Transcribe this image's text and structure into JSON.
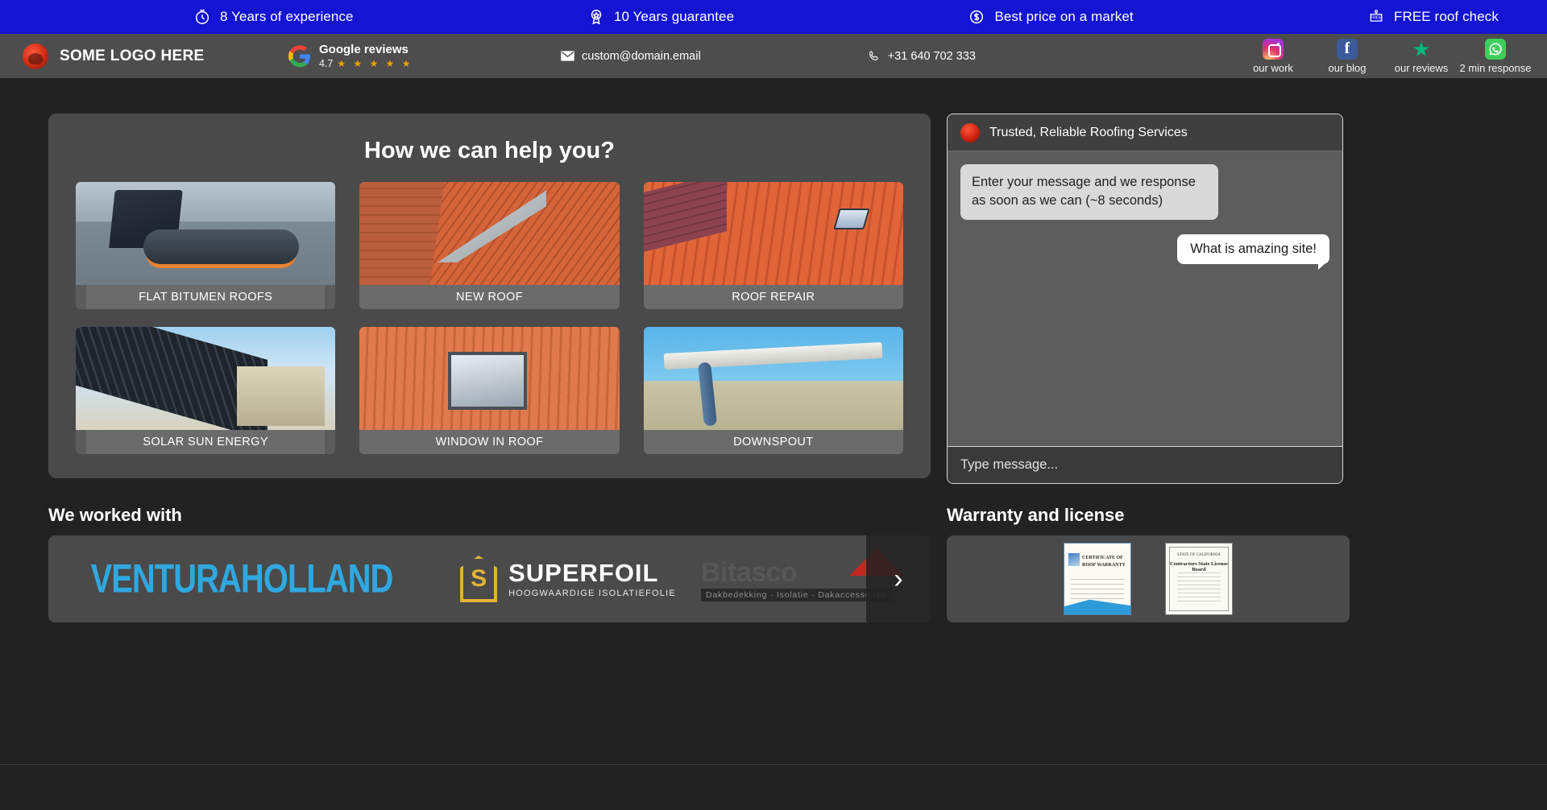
{
  "promo_bar": {
    "background": "#1414d2",
    "items": [
      {
        "icon": "clock-icon",
        "label": "8 Years of experience"
      },
      {
        "icon": "guarantee-badge-icon",
        "label": "10 Years guarantee"
      },
      {
        "icon": "dollar-coin-icon",
        "label": "Best price on a market"
      },
      {
        "icon": "free-tag-icon",
        "label": "FREE roof check"
      }
    ]
  },
  "header": {
    "brand": {
      "logo": "company-logo-icon",
      "name": "SOME LOGO HERE"
    },
    "google": {
      "icon": "google-g-icon",
      "title": "Google reviews",
      "score": "4.7",
      "stars": "★ ★ ★ ★ ★",
      "star_color": "#f0a202"
    },
    "email": {
      "icon": "mail-icon",
      "value": "custom@domain.email"
    },
    "phone": {
      "icon": "phone-icon",
      "value": "+31 640 702 333"
    },
    "socials": [
      {
        "icon": "instagram-icon",
        "label": "our work"
      },
      {
        "icon": "facebook-icon",
        "label": "our blog"
      },
      {
        "icon": "trustpilot-star-icon",
        "label": "our reviews"
      },
      {
        "icon": "whatsapp-icon",
        "label": "2 min response"
      }
    ]
  },
  "services": {
    "title": "How we can help you?",
    "tiles": [
      {
        "label": "FLAT BITUMEN ROOFS",
        "art": "bitumen"
      },
      {
        "label": "NEW ROOF",
        "art": "brickwall"
      },
      {
        "label": "ROOF REPAIR",
        "art": "tilesroof"
      },
      {
        "label": "SOLAR SUN ENERGY",
        "art": "solar"
      },
      {
        "label": "WINDOW IN ROOF",
        "art": "skylight"
      },
      {
        "label": "DOWNSPOUT",
        "art": "gutter"
      }
    ]
  },
  "chat": {
    "title": "Trusted, Reliable Roofing Services",
    "avatar": "company-logo-icon",
    "messages": [
      {
        "from": "bot",
        "text": "Enter your message and we response as soon as we can (~8 seconds)"
      },
      {
        "from": "user",
        "text": "What is amazing site!"
      }
    ],
    "input_placeholder": "Type message...",
    "input_value": ""
  },
  "partners": {
    "heading": "We worked with",
    "logos": [
      {
        "name": "venturaholland-logo",
        "text": "VENTURAHOLLAND",
        "color": "#2fa8e0"
      },
      {
        "name": "superfoil-logo",
        "text": "SUPERFOIL",
        "tagline": "HOOGWAARDIGE ISOLATIEFOLIE"
      },
      {
        "name": "bitasco-logo",
        "text": "Bitasco",
        "tagline": "Dakbedekking · Isolatie · Dakaccessoires"
      }
    ],
    "next_label": "›"
  },
  "warranty": {
    "heading": "Warranty and license",
    "documents": [
      {
        "name": "roof-warranty-certificate",
        "title": "CERTIFICATE OF ROOF WARRANTY"
      },
      {
        "name": "contractors-state-license-board",
        "head": "STATE OF CALIFORNIA",
        "title": "Contractors State License Board"
      }
    ]
  }
}
